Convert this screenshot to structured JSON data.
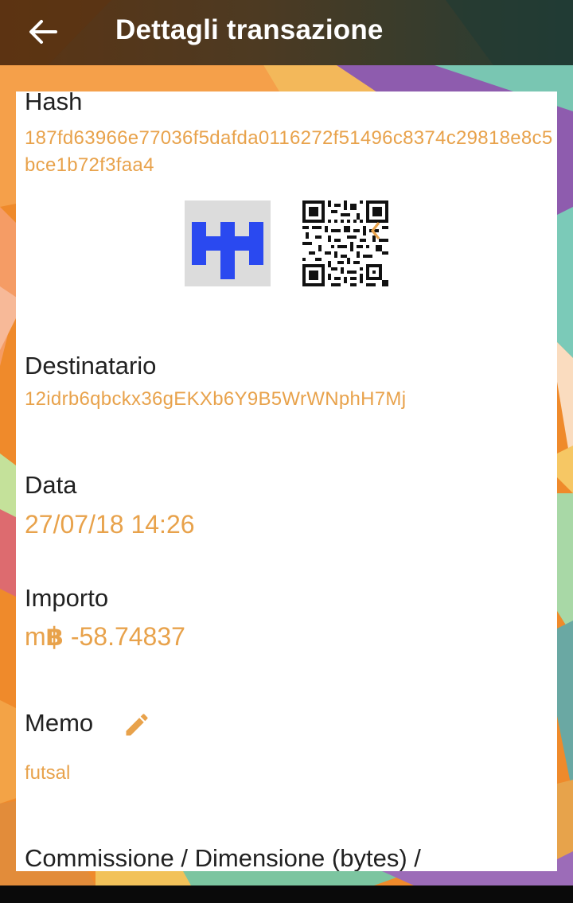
{
  "appbar": {
    "title": "Dettagli transazione",
    "back_icon": "arrow-back-icon"
  },
  "transaction": {
    "hash_label": "Hash",
    "hash_value": "187fd63966e77036f5dafda0116272f51496c8374c29818e8c5bce1b72f3faa4",
    "recipient_label": "Destinatario",
    "recipient_value": "12idrb6qbckx36gEKXb6Y9B5WrWNphH7Mj",
    "date_label": "Data",
    "date_value": "27/07/18 14:26",
    "amount_label": "Importo",
    "amount_unit_prefix": "m",
    "amount_unit_symbol": "฿",
    "amount_value": " -58.74837",
    "memo_label": "Memo",
    "memo_value": "futsal",
    "fee_label": "Commissione / Dimensione (bytes) /"
  },
  "icons": {
    "edit": "pencil-icon",
    "identicon": "identicon-image",
    "qr": "qr-code-image"
  },
  "colors": {
    "accent": "#e8a24b",
    "text": "#212121",
    "identicon": "#2a49f0",
    "identicon_bg": "#dcdcdc",
    "appbar_left": "#5a3516",
    "appbar_right": "#233d35"
  }
}
